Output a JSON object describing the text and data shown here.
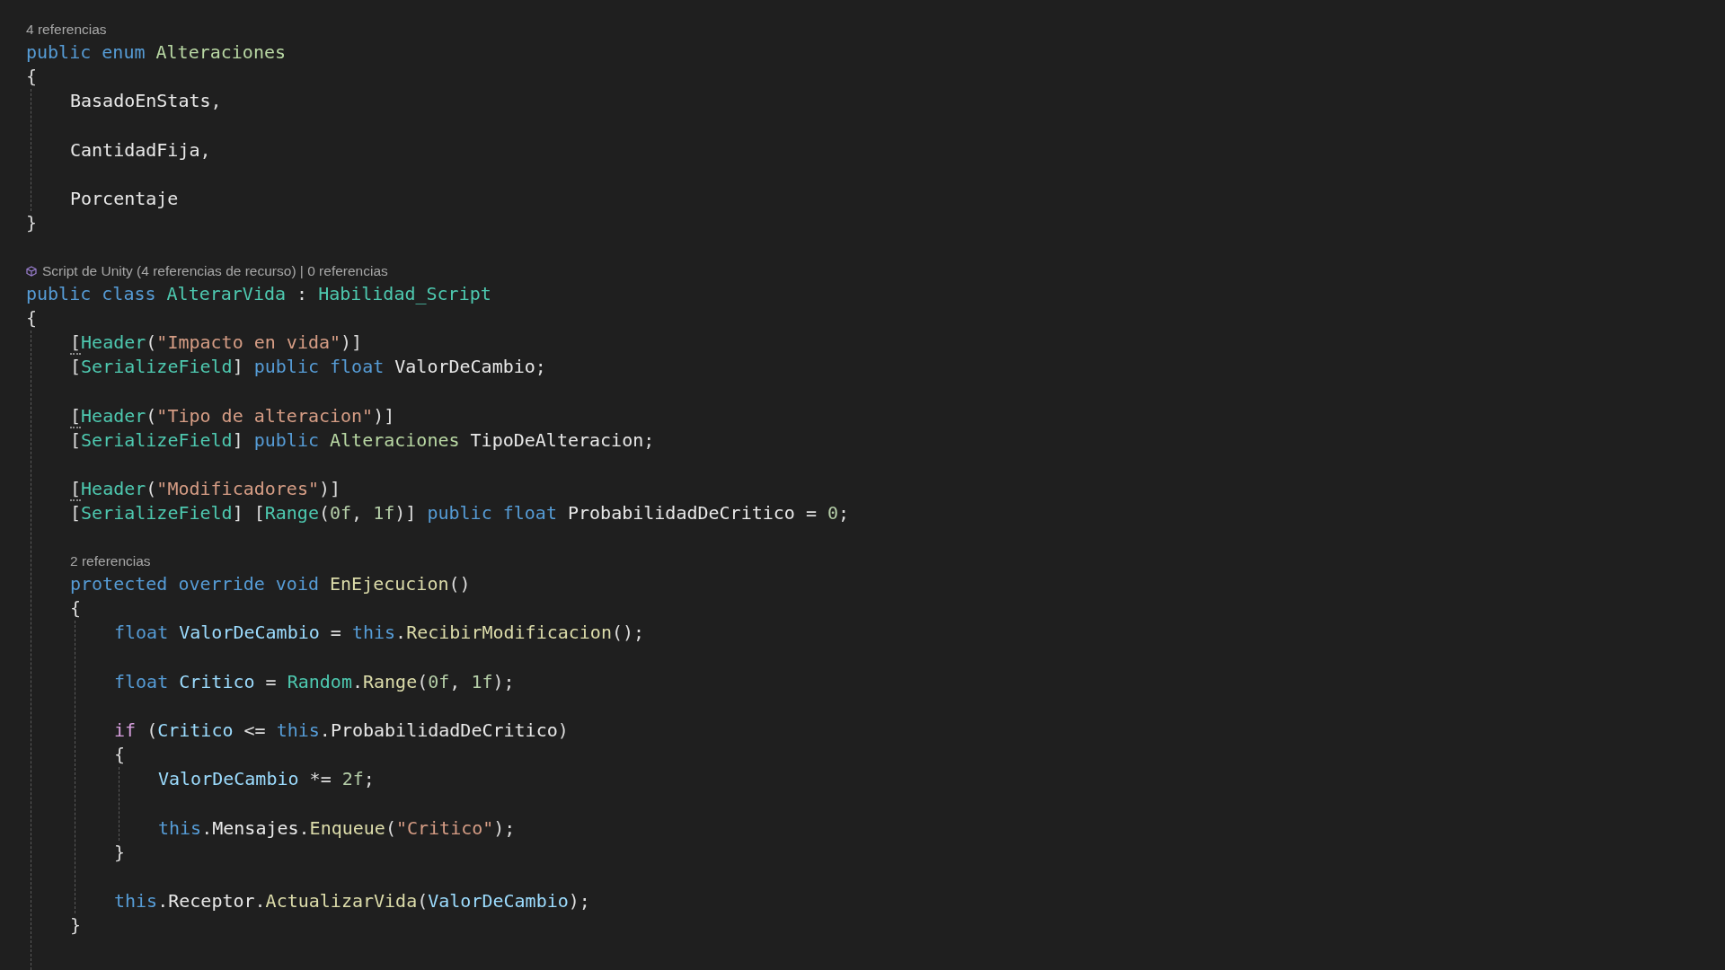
{
  "editor": {
    "lines": [
      {
        "kind": "lens",
        "text": "4 referencias"
      },
      {
        "kind": "code",
        "tokens": [
          {
            "text": "public ",
            "kind": "kw"
          },
          {
            "text": "enum ",
            "kind": "kw"
          },
          {
            "text": "Alteraciones",
            "kind": "enum"
          }
        ]
      },
      {
        "kind": "code",
        "tokens": [
          {
            "text": "{",
            "kind": "punct"
          }
        ]
      },
      {
        "kind": "block",
        "children": [
          {
            "kind": "code",
            "tokens": [
              {
                "text": "BasadoEnStats",
                "kind": "member"
              },
              {
                "text": ",",
                "kind": "punct"
              }
            ]
          },
          {
            "kind": "blank"
          },
          {
            "kind": "code",
            "tokens": [
              {
                "text": "CantidadFija",
                "kind": "member"
              },
              {
                "text": ",",
                "kind": "punct"
              }
            ]
          },
          {
            "kind": "blank"
          },
          {
            "kind": "code",
            "tokens": [
              {
                "text": "Porcentaje",
                "kind": "member"
              }
            ]
          }
        ]
      },
      {
        "kind": "code",
        "tokens": [
          {
            "text": "}",
            "kind": "punct"
          }
        ]
      },
      {
        "kind": "blank"
      },
      {
        "kind": "unitylens",
        "text": "Script de Unity (4 referencias de recurso) | 0 referencias"
      },
      {
        "kind": "code",
        "tokens": [
          {
            "text": "public ",
            "kind": "kw"
          },
          {
            "text": "class ",
            "kind": "kw"
          },
          {
            "text": "AlterarVida",
            "kind": "type"
          },
          {
            "text": " : ",
            "kind": "punct"
          },
          {
            "text": "Habilidad_Script",
            "kind": "type"
          }
        ]
      },
      {
        "kind": "code",
        "tokens": [
          {
            "text": "{",
            "kind": "punct"
          }
        ]
      },
      {
        "kind": "block",
        "children": [
          {
            "kind": "code",
            "tokens": [
              {
                "text": "[",
                "kind": "hintpunct"
              },
              {
                "text": "Header",
                "kind": "type"
              },
              {
                "text": "(",
                "kind": "punct"
              },
              {
                "text": "\"Impacto en vida\"",
                "kind": "str"
              },
              {
                "text": ")]",
                "kind": "punct"
              }
            ]
          },
          {
            "kind": "code",
            "tokens": [
              {
                "text": "[",
                "kind": "punct"
              },
              {
                "text": "SerializeField",
                "kind": "type"
              },
              {
                "text": "] ",
                "kind": "punct"
              },
              {
                "text": "public ",
                "kind": "kw"
              },
              {
                "text": "float ",
                "kind": "kw"
              },
              {
                "text": "ValorDeCambio",
                "kind": "field"
              },
              {
                "text": ";",
                "kind": "punct"
              }
            ]
          },
          {
            "kind": "blank"
          },
          {
            "kind": "code",
            "tokens": [
              {
                "text": "[",
                "kind": "hintpunct"
              },
              {
                "text": "Header",
                "kind": "type"
              },
              {
                "text": "(",
                "kind": "punct"
              },
              {
                "text": "\"Tipo de alteracion\"",
                "kind": "str"
              },
              {
                "text": ")]",
                "kind": "punct"
              }
            ]
          },
          {
            "kind": "code",
            "tokens": [
              {
                "text": "[",
                "kind": "punct"
              },
              {
                "text": "SerializeField",
                "kind": "type"
              },
              {
                "text": "] ",
                "kind": "punct"
              },
              {
                "text": "public ",
                "kind": "kw"
              },
              {
                "text": "Alteraciones ",
                "kind": "enum"
              },
              {
                "text": "TipoDeAlteracion",
                "kind": "field"
              },
              {
                "text": ";",
                "kind": "punct"
              }
            ]
          },
          {
            "kind": "blank"
          },
          {
            "kind": "code",
            "tokens": [
              {
                "text": "[",
                "kind": "hintpunct"
              },
              {
                "text": "Header",
                "kind": "type"
              },
              {
                "text": "(",
                "kind": "punct"
              },
              {
                "text": "\"Modificadores\"",
                "kind": "str"
              },
              {
                "text": ")]",
                "kind": "punct"
              }
            ]
          },
          {
            "kind": "code",
            "tokens": [
              {
                "text": "[",
                "kind": "punct"
              },
              {
                "text": "SerializeField",
                "kind": "type"
              },
              {
                "text": "] [",
                "kind": "punct"
              },
              {
                "text": "Range",
                "kind": "type"
              },
              {
                "text": "(",
                "kind": "punct"
              },
              {
                "text": "0f",
                "kind": "num"
              },
              {
                "text": ", ",
                "kind": "punct"
              },
              {
                "text": "1f",
                "kind": "num"
              },
              {
                "text": ")] ",
                "kind": "punct"
              },
              {
                "text": "public ",
                "kind": "kw"
              },
              {
                "text": "float ",
                "kind": "kw"
              },
              {
                "text": "ProbabilidadDeCritico",
                "kind": "field"
              },
              {
                "text": " = ",
                "kind": "punct"
              },
              {
                "text": "0",
                "kind": "num"
              },
              {
                "text": ";",
                "kind": "punct"
              }
            ]
          },
          {
            "kind": "blank"
          },
          {
            "kind": "lens",
            "text": "2 referencias"
          },
          {
            "kind": "code",
            "tokens": [
              {
                "text": "protected ",
                "kind": "kw"
              },
              {
                "text": "override ",
                "kind": "kw"
              },
              {
                "text": "void ",
                "kind": "kw"
              },
              {
                "text": "EnEjecucion",
                "kind": "method"
              },
              {
                "text": "()",
                "kind": "punct"
              }
            ]
          },
          {
            "kind": "code",
            "tokens": [
              {
                "text": "{",
                "kind": "punct"
              }
            ]
          },
          {
            "kind": "block",
            "children": [
              {
                "kind": "code",
                "tokens": [
                  {
                    "text": "float ",
                    "kind": "kw"
                  },
                  {
                    "text": "ValorDeCambio",
                    "kind": "local"
                  },
                  {
                    "text": " = ",
                    "kind": "punct"
                  },
                  {
                    "text": "this",
                    "kind": "kw"
                  },
                  {
                    "text": ".",
                    "kind": "punct"
                  },
                  {
                    "text": "RecibirModificacion",
                    "kind": "method"
                  },
                  {
                    "text": "();",
                    "kind": "punct"
                  }
                ]
              },
              {
                "kind": "blank"
              },
              {
                "kind": "code",
                "tokens": [
                  {
                    "text": "float ",
                    "kind": "kw"
                  },
                  {
                    "text": "Critico",
                    "kind": "local"
                  },
                  {
                    "text": " = ",
                    "kind": "punct"
                  },
                  {
                    "text": "Random",
                    "kind": "type"
                  },
                  {
                    "text": ".",
                    "kind": "punct"
                  },
                  {
                    "text": "Range",
                    "kind": "method"
                  },
                  {
                    "text": "(",
                    "kind": "punct"
                  },
                  {
                    "text": "0f",
                    "kind": "num"
                  },
                  {
                    "text": ", ",
                    "kind": "punct"
                  },
                  {
                    "text": "1f",
                    "kind": "num"
                  },
                  {
                    "text": ");",
                    "kind": "punct"
                  }
                ]
              },
              {
                "kind": "blank"
              },
              {
                "kind": "code",
                "tokens": [
                  {
                    "text": "if",
                    "kind": "ctl"
                  },
                  {
                    "text": " (",
                    "kind": "punct"
                  },
                  {
                    "text": "Critico",
                    "kind": "local"
                  },
                  {
                    "text": " <= ",
                    "kind": "punct"
                  },
                  {
                    "text": "this",
                    "kind": "kw"
                  },
                  {
                    "text": ".",
                    "kind": "punct"
                  },
                  {
                    "text": "ProbabilidadDeCritico",
                    "kind": "field"
                  },
                  {
                    "text": ")",
                    "kind": "punct"
                  }
                ]
              },
              {
                "kind": "code",
                "tokens": [
                  {
                    "text": "{",
                    "kind": "punct"
                  }
                ]
              },
              {
                "kind": "block",
                "children": [
                  {
                    "kind": "code",
                    "tokens": [
                      {
                        "text": "ValorDeCambio",
                        "kind": "local"
                      },
                      {
                        "text": " *= ",
                        "kind": "punct"
                      },
                      {
                        "text": "2f",
                        "kind": "num"
                      },
                      {
                        "text": ";",
                        "kind": "punct"
                      }
                    ]
                  },
                  {
                    "kind": "blank"
                  },
                  {
                    "kind": "code",
                    "tokens": [
                      {
                        "text": "this",
                        "kind": "kw"
                      },
                      {
                        "text": ".",
                        "kind": "punct"
                      },
                      {
                        "text": "Mensajes",
                        "kind": "field"
                      },
                      {
                        "text": ".",
                        "kind": "punct"
                      },
                      {
                        "text": "Enqueue",
                        "kind": "method"
                      },
                      {
                        "text": "(",
                        "kind": "punct"
                      },
                      {
                        "text": "\"Critico\"",
                        "kind": "str"
                      },
                      {
                        "text": ");",
                        "kind": "punct"
                      }
                    ]
                  }
                ]
              },
              {
                "kind": "code",
                "tokens": [
                  {
                    "text": "}",
                    "kind": "punct"
                  }
                ]
              },
              {
                "kind": "blank"
              },
              {
                "kind": "code",
                "tokens": [
                  {
                    "text": "this",
                    "kind": "kw"
                  },
                  {
                    "text": ".",
                    "kind": "punct"
                  },
                  {
                    "text": "Receptor",
                    "kind": "field"
                  },
                  {
                    "text": ".",
                    "kind": "punct"
                  },
                  {
                    "text": "ActualizarVida",
                    "kind": "method"
                  },
                  {
                    "text": "(",
                    "kind": "punct"
                  },
                  {
                    "text": "ValorDeCambio",
                    "kind": "local"
                  },
                  {
                    "text": ");",
                    "kind": "punct"
                  }
                ]
              }
            ]
          },
          {
            "kind": "code",
            "tokens": [
              {
                "text": "}",
                "kind": "punct"
              }
            ]
          },
          {
            "kind": "blank"
          }
        ]
      }
    ]
  }
}
